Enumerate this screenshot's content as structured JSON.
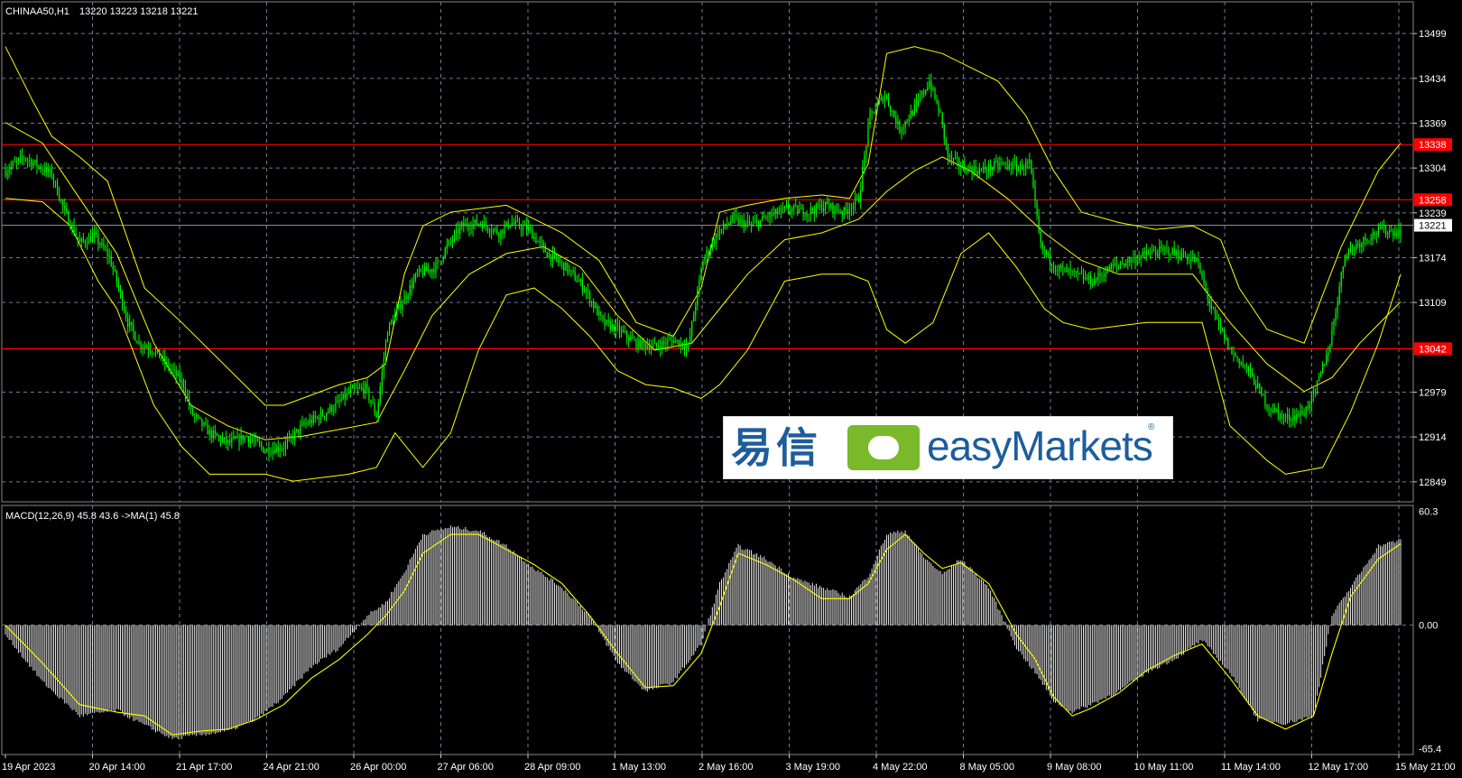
{
  "header": {
    "symbol": "CHINAA50,H1",
    "ohlc": "13220 13223 13218 13221"
  },
  "indicator": {
    "label": "MACD(12,26,9) 45.8 43.6  ->MA(1) 45.8"
  },
  "logo": {
    "cn": "易信",
    "en": "easyMarkets",
    "reg": "®"
  },
  "colors": {
    "background": "#000000",
    "grid": "#6e7e8e",
    "candle": "#00ff00",
    "band": "#ffff00",
    "level": "#ff0000",
    "histogram": "#ffffff",
    "signal": "#ffff00"
  },
  "chart_data": [
    {
      "type": "candlestick",
      "title": "CHINAA50,H1",
      "indicators": [
        "Bollinger Bands"
      ],
      "x_labels": [
        "19 Apr 2023",
        "20 Apr 14:00",
        "21 Apr 17:00",
        "24 Apr 21:00",
        "26 Apr 00:00",
        "27 Apr 06:00",
        "28 Apr 09:00",
        "1 May 13:00",
        "2 May 16:00",
        "3 May 19:00",
        "4 May 22:00",
        "8 May 05:00",
        "9 May 08:00",
        "10 May 11:00",
        "11 May 14:00",
        "12 May 17:00",
        "15 May 21:00"
      ],
      "y_ticks": [
        13499,
        13434,
        13369,
        13304,
        13239,
        13174,
        13109,
        12979,
        12914,
        12849
      ],
      "ylim": [
        12820,
        13545
      ],
      "last_price": 13221,
      "horizontal_levels": [
        13338,
        13258,
        13042
      ],
      "close_path": [
        [
          0,
          13300
        ],
        [
          10,
          13320
        ],
        [
          25,
          13295
        ],
        [
          32,
          13240
        ],
        [
          40,
          13195
        ],
        [
          48,
          13205
        ],
        [
          56,
          13175
        ],
        [
          60,
          13140
        ],
        [
          66,
          13080
        ],
        [
          72,
          13050
        ],
        [
          80,
          13040
        ],
        [
          90,
          13010
        ],
        [
          96,
          12990
        ],
        [
          100,
          12950
        ],
        [
          110,
          12920
        ],
        [
          120,
          12905
        ],
        [
          130,
          12915
        ],
        [
          140,
          12895
        ],
        [
          150,
          12900
        ],
        [
          160,
          12930
        ],
        [
          170,
          12945
        ],
        [
          178,
          12960
        ],
        [
          186,
          12980
        ],
        [
          194,
          12985
        ],
        [
          200,
          12945
        ],
        [
          206,
          13070
        ],
        [
          214,
          13110
        ],
        [
          222,
          13150
        ],
        [
          232,
          13160
        ],
        [
          238,
          13190
        ],
        [
          246,
          13220
        ],
        [
          256,
          13225
        ],
        [
          266,
          13210
        ],
        [
          272,
          13225
        ],
        [
          282,
          13215
        ],
        [
          292,
          13180
        ],
        [
          302,
          13160
        ],
        [
          312,
          13130
        ],
        [
          322,
          13080
        ],
        [
          330,
          13070
        ],
        [
          340,
          13050
        ],
        [
          350,
          13045
        ],
        [
          360,
          13055
        ],
        [
          368,
          13045
        ],
        [
          376,
          13170
        ],
        [
          384,
          13210
        ],
        [
          392,
          13230
        ],
        [
          402,
          13220
        ],
        [
          412,
          13235
        ],
        [
          422,
          13245
        ],
        [
          432,
          13240
        ],
        [
          442,
          13250
        ],
        [
          452,
          13240
        ],
        [
          460,
          13260
        ],
        [
          466,
          13380
        ],
        [
          474,
          13410
        ],
        [
          482,
          13360
        ],
        [
          490,
          13390
        ],
        [
          498,
          13430
        ],
        [
          504,
          13380
        ],
        [
          508,
          13320
        ],
        [
          516,
          13305
        ],
        [
          526,
          13300
        ],
        [
          536,
          13310
        ],
        [
          546,
          13305
        ],
        [
          552,
          13310
        ],
        [
          558,
          13190
        ],
        [
          566,
          13160
        ],
        [
          576,
          13150
        ],
        [
          586,
          13140
        ],
        [
          596,
          13160
        ],
        [
          606,
          13170
        ],
        [
          616,
          13180
        ],
        [
          626,
          13185
        ],
        [
          636,
          13175
        ],
        [
          642,
          13170
        ],
        [
          650,
          13100
        ],
        [
          660,
          13040
        ],
        [
          670,
          13010
        ],
        [
          680,
          12960
        ],
        [
          690,
          12940
        ],
        [
          700,
          12950
        ],
        [
          706,
          12980
        ],
        [
          714,
          13050
        ],
        [
          722,
          13180
        ],
        [
          732,
          13200
        ],
        [
          742,
          13215
        ],
        [
          752,
          13210
        ]
      ],
      "upper_band_path": [
        [
          0,
          13480
        ],
        [
          15,
          13400
        ],
        [
          25,
          13350
        ],
        [
          40,
          13320
        ],
        [
          55,
          13285
        ],
        [
          75,
          13130
        ],
        [
          95,
          13080
        ],
        [
          110,
          13040
        ],
        [
          125,
          13000
        ],
        [
          140,
          12960
        ],
        [
          150,
          12960
        ],
        [
          165,
          12975
        ],
        [
          180,
          12990
        ],
        [
          195,
          13000
        ],
        [
          205,
          13020
        ],
        [
          215,
          13150
        ],
        [
          225,
          13220
        ],
        [
          240,
          13240
        ],
        [
          255,
          13245
        ],
        [
          270,
          13250
        ],
        [
          285,
          13230
        ],
        [
          300,
          13210
        ],
        [
          320,
          13170
        ],
        [
          340,
          13080
        ],
        [
          360,
          13060
        ],
        [
          375,
          13130
        ],
        [
          385,
          13240
        ],
        [
          400,
          13250
        ],
        [
          420,
          13260
        ],
        [
          440,
          13265
        ],
        [
          455,
          13260
        ],
        [
          465,
          13310
        ],
        [
          475,
          13470
        ],
        [
          490,
          13480
        ],
        [
          505,
          13470
        ],
        [
          520,
          13450
        ],
        [
          535,
          13430
        ],
        [
          550,
          13380
        ],
        [
          565,
          13300
        ],
        [
          580,
          13240
        ],
        [
          600,
          13225
        ],
        [
          620,
          13215
        ],
        [
          640,
          13220
        ],
        [
          655,
          13200
        ],
        [
          665,
          13130
        ],
        [
          680,
          13070
        ],
        [
          700,
          13050
        ],
        [
          720,
          13190
        ],
        [
          740,
          13300
        ],
        [
          752,
          13340
        ]
      ],
      "lower_band_path": [
        [
          0,
          13260
        ],
        [
          20,
          13255
        ],
        [
          35,
          13220
        ],
        [
          50,
          13140
        ],
        [
          60,
          13100
        ],
        [
          80,
          12960
        ],
        [
          95,
          12900
        ],
        [
          110,
          12860
        ],
        [
          125,
          12860
        ],
        [
          140,
          12860
        ],
        [
          155,
          12850
        ],
        [
          170,
          12855
        ],
        [
          185,
          12860
        ],
        [
          200,
          12870
        ],
        [
          210,
          12920
        ],
        [
          225,
          12870
        ],
        [
          240,
          12920
        ],
        [
          255,
          13040
        ],
        [
          270,
          13120
        ],
        [
          285,
          13130
        ],
        [
          300,
          13100
        ],
        [
          315,
          13060
        ],
        [
          330,
          13010
        ],
        [
          345,
          12990
        ],
        [
          360,
          12985
        ],
        [
          375,
          12970
        ],
        [
          385,
          12990
        ],
        [
          400,
          13040
        ],
        [
          420,
          13140
        ],
        [
          440,
          13150
        ],
        [
          455,
          13150
        ],
        [
          465,
          13140
        ],
        [
          475,
          13070
        ],
        [
          485,
          13050
        ],
        [
          500,
          13080
        ],
        [
          515,
          13180
        ],
        [
          530,
          13210
        ],
        [
          545,
          13160
        ],
        [
          560,
          13100
        ],
        [
          570,
          13080
        ],
        [
          585,
          13070
        ],
        [
          600,
          13075
        ],
        [
          615,
          13080
        ],
        [
          630,
          13080
        ],
        [
          645,
          13080
        ],
        [
          660,
          12930
        ],
        [
          680,
          12880
        ],
        [
          690,
          12860
        ],
        [
          700,
          12865
        ],
        [
          710,
          12870
        ],
        [
          725,
          12950
        ],
        [
          740,
          13050
        ],
        [
          752,
          13150
        ]
      ],
      "middle_band_path": [
        [
          0,
          13370
        ],
        [
          20,
          13340
        ],
        [
          40,
          13260
        ],
        [
          60,
          13180
        ],
        [
          80,
          13050
        ],
        [
          100,
          12960
        ],
        [
          120,
          12930
        ],
        [
          140,
          12910
        ],
        [
          160,
          12915
        ],
        [
          180,
          12925
        ],
        [
          200,
          12935
        ],
        [
          215,
          13010
        ],
        [
          230,
          13090
        ],
        [
          250,
          13150
        ],
        [
          270,
          13180
        ],
        [
          290,
          13190
        ],
        [
          310,
          13160
        ],
        [
          330,
          13090
        ],
        [
          350,
          13040
        ],
        [
          370,
          13050
        ],
        [
          385,
          13100
        ],
        [
          400,
          13150
        ],
        [
          420,
          13200
        ],
        [
          440,
          13210
        ],
        [
          460,
          13230
        ],
        [
          475,
          13270
        ],
        [
          490,
          13300
        ],
        [
          505,
          13320
        ],
        [
          520,
          13300
        ],
        [
          540,
          13260
        ],
        [
          560,
          13210
        ],
        [
          580,
          13170
        ],
        [
          600,
          13150
        ],
        [
          620,
          13150
        ],
        [
          640,
          13150
        ],
        [
          660,
          13080
        ],
        [
          680,
          13020
        ],
        [
          700,
          12980
        ],
        [
          715,
          13000
        ],
        [
          730,
          13050
        ],
        [
          752,
          13110
        ]
      ]
    },
    {
      "type": "bar",
      "title": "MACD(12,26,9)",
      "y_ticks": [
        60.3,
        0.0,
        -65.4
      ],
      "ylim": [
        -65.4,
        60.3
      ],
      "histogram_path": [
        [
          0,
          -5
        ],
        [
          20,
          -30
        ],
        [
          40,
          -48
        ],
        [
          60,
          -45
        ],
        [
          75,
          -53
        ],
        [
          90,
          -60
        ],
        [
          105,
          -58
        ],
        [
          120,
          -56
        ],
        [
          135,
          -50
        ],
        [
          150,
          -38
        ],
        [
          165,
          -22
        ],
        [
          180,
          -12
        ],
        [
          195,
          5
        ],
        [
          205,
          12
        ],
        [
          215,
          28
        ],
        [
          225,
          48
        ],
        [
          240,
          52
        ],
        [
          255,
          50
        ],
        [
          270,
          42
        ],
        [
          285,
          30
        ],
        [
          300,
          20
        ],
        [
          315,
          5
        ],
        [
          330,
          -20
        ],
        [
          345,
          -35
        ],
        [
          360,
          -30
        ],
        [
          375,
          -10
        ],
        [
          385,
          22
        ],
        [
          395,
          42
        ],
        [
          410,
          35
        ],
        [
          425,
          25
        ],
        [
          440,
          20
        ],
        [
          455,
          15
        ],
        [
          465,
          26
        ],
        [
          475,
          48
        ],
        [
          485,
          50
        ],
        [
          495,
          36
        ],
        [
          505,
          27
        ],
        [
          515,
          35
        ],
        [
          530,
          20
        ],
        [
          545,
          -12
        ],
        [
          555,
          -25
        ],
        [
          565,
          -40
        ],
        [
          575,
          -46
        ],
        [
          585,
          -42
        ],
        [
          600,
          -35
        ],
        [
          615,
          -25
        ],
        [
          630,
          -18
        ],
        [
          645,
          -8
        ],
        [
          660,
          -25
        ],
        [
          675,
          -50
        ],
        [
          690,
          -52
        ],
        [
          705,
          -48
        ],
        [
          715,
          5
        ],
        [
          725,
          20
        ],
        [
          740,
          42
        ],
        [
          752,
          45
        ]
      ],
      "signal_path": [
        [
          0,
          0
        ],
        [
          20,
          -20
        ],
        [
          40,
          -42
        ],
        [
          60,
          -46
        ],
        [
          75,
          -48
        ],
        [
          90,
          -58
        ],
        [
          105,
          -56
        ],
        [
          120,
          -55
        ],
        [
          135,
          -50
        ],
        [
          150,
          -42
        ],
        [
          165,
          -28
        ],
        [
          180,
          -18
        ],
        [
          195,
          -5
        ],
        [
          205,
          5
        ],
        [
          215,
          18
        ],
        [
          225,
          38
        ],
        [
          240,
          48
        ],
        [
          255,
          48
        ],
        [
          270,
          40
        ],
        [
          285,
          32
        ],
        [
          300,
          22
        ],
        [
          315,
          5
        ],
        [
          330,
          -15
        ],
        [
          345,
          -33
        ],
        [
          360,
          -32
        ],
        [
          375,
          -15
        ],
        [
          385,
          10
        ],
        [
          395,
          38
        ],
        [
          410,
          32
        ],
        [
          425,
          24
        ],
        [
          440,
          14
        ],
        [
          455,
          14
        ],
        [
          465,
          22
        ],
        [
          475,
          40
        ],
        [
          485,
          48
        ],
        [
          495,
          38
        ],
        [
          505,
          30
        ],
        [
          515,
          33
        ],
        [
          530,
          22
        ],
        [
          545,
          -5
        ],
        [
          555,
          -18
        ],
        [
          565,
          -38
        ],
        [
          575,
          -48
        ],
        [
          585,
          -44
        ],
        [
          600,
          -36
        ],
        [
          615,
          -24
        ],
        [
          630,
          -16
        ],
        [
          645,
          -10
        ],
        [
          660,
          -28
        ],
        [
          675,
          -48
        ],
        [
          690,
          -55
        ],
        [
          705,
          -48
        ],
        [
          715,
          -15
        ],
        [
          725,
          15
        ],
        [
          740,
          35
        ],
        [
          752,
          43
        ]
      ]
    }
  ]
}
